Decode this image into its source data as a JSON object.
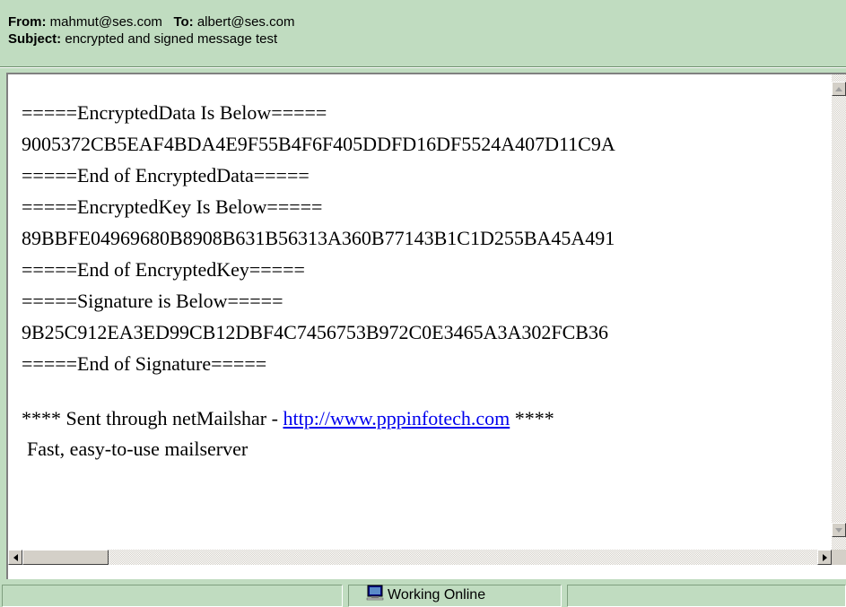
{
  "header": {
    "from_label": "From:",
    "from_value": "mahmut@ses.com",
    "to_label": "To:",
    "to_value": "albert@ses.com",
    "subject_label": "Subject:",
    "subject_value": "encrypted and signed message test"
  },
  "message": {
    "lines": [
      "=====EncryptedData Is Below=====",
      "9005372CB5EAF4BDA4E9F55B4F6F405DDFD16DF5524A407D11C9A",
      "=====End of EncryptedData=====",
      "=====EncryptedKey Is Below=====",
      "89BBFE04969680B8908B631B56313A360B77143B1C1D255BA45A491",
      "=====End of EncryptedKey=====",
      "=====Signature is Below=====",
      "9B25C912EA3ED99CB12DBF4C7456753B972C0E3465A3A302FCB36",
      "=====End of Signature====="
    ],
    "footer_prefix": "**** Sent through netMailshar - ",
    "footer_link": "http://www.pppinfotech.com",
    "footer_suffix": " ****",
    "tagline": "Fast, easy-to-use mailserver"
  },
  "statusbar": {
    "connection_status": "Working Online",
    "connection_icon": "computer-icon"
  },
  "icons": {
    "scroll_up": "arrow-up-icon",
    "scroll_down": "arrow-down-icon",
    "scroll_left": "arrow-left-icon",
    "scroll_right": "arrow-right-icon"
  }
}
